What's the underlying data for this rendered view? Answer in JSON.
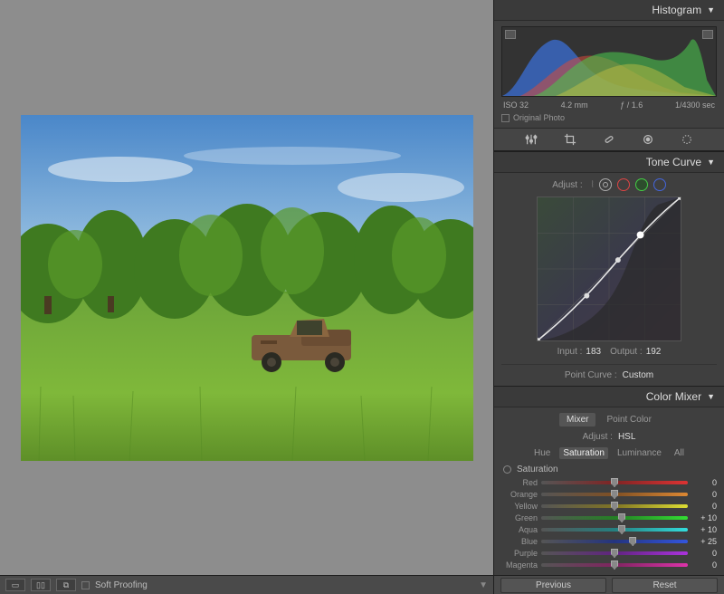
{
  "histogram": {
    "title": "Histogram",
    "meta": {
      "iso": "ISO 32",
      "focal": "4.2 mm",
      "aperture": "ƒ / 1.6",
      "shutter": "1/4300 sec"
    },
    "original_photo_label": "Original Photo"
  },
  "tone_curve": {
    "title": "Tone Curve",
    "adjust_label": "Adjust :",
    "input_label": "Input :",
    "input_value": "183",
    "output_label": "Output :",
    "output_value": "192",
    "point_curve_label": "Point Curve :",
    "point_curve_value": "Custom"
  },
  "color_mixer": {
    "title": "Color Mixer",
    "tabs": {
      "mixer": "Mixer",
      "point_color": "Point Color"
    },
    "adjust_label": "Adjust :",
    "adjust_mode": "HSL",
    "subtabs": {
      "hue": "Hue",
      "saturation": "Saturation",
      "luminance": "Luminance",
      "all": "All"
    },
    "section_label": "Saturation",
    "sliders": [
      {
        "name": "Red",
        "value": 0,
        "gradient": [
          "#994444",
          "#802424",
          "#d33"
        ]
      },
      {
        "name": "Orange",
        "value": 0,
        "gradient": [
          "#86613b",
          "#805024",
          "#d83"
        ]
      },
      {
        "name": "Yellow",
        "value": 0,
        "gradient": [
          "#86863b",
          "#807424",
          "#dd3"
        ]
      },
      {
        "name": "Green",
        "value": 10,
        "gradient": [
          "#5a8a5a",
          "#248024",
          "#3d3"
        ]
      },
      {
        "name": "Aqua",
        "value": 10,
        "gradient": [
          "#5a8a8a",
          "#248080",
          "#3dd"
        ]
      },
      {
        "name": "Blue",
        "value": 25,
        "gradient": [
          "#5a6a9a",
          "#243480",
          "#35d"
        ]
      },
      {
        "name": "Purple",
        "value": 0,
        "gradient": [
          "#7a5a8a",
          "#602480",
          "#a3d"
        ]
      },
      {
        "name": "Magenta",
        "value": 0,
        "gradient": [
          "#8a5a7a",
          "#802460",
          "#d3a"
        ]
      }
    ]
  },
  "footer": {
    "soft_proofing_label": "Soft Proofing",
    "previous_label": "Previous",
    "reset_label": "Reset"
  }
}
